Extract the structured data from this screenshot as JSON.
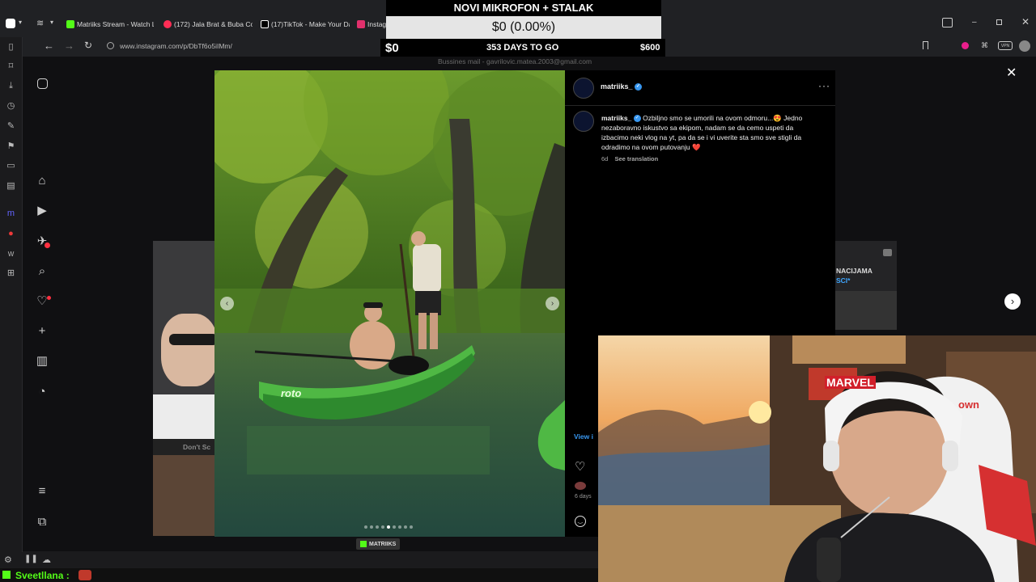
{
  "browser": {
    "tabs": [
      {
        "label": "Matriiks Stream - Watch Liv",
        "color": "#53fc18"
      },
      {
        "label": "(172) Jala Brat & Buba Corr",
        "color": "#ff2d55"
      },
      {
        "label": "(17)TikTok - Make Your Day",
        "color": "#ffffff"
      },
      {
        "label": "Instag",
        "color": "#e1306c"
      }
    ],
    "url": "www.instagram.com/p/DbTf6o5iIMm/"
  },
  "overlay": {
    "banner": "NOVI MIKROFON + STALAK",
    "goal_percent_text": "$0 (0.00%)",
    "goal_current": "$0",
    "days_to_go": "353 DAYS TO GO",
    "goal_target": "$600",
    "business_mail": "Bussines mail - gavrilovic.matea.2003@gmail.com"
  },
  "post": {
    "username": "matriiks_",
    "caption_user": "matriiks_",
    "caption": "Ozbiljno smo se umorili na ovom odmoru...😍 Jedno nezaboravno iskustvo sa ekipom, nadam se da cemo uspeti da izbacimo neki vlog na yt, pa da se i vi uverite sta smo sve stigli da odradimo na ovom putovanju ❤️",
    "age": "6d",
    "see_translation": "See translation",
    "view_text": "View i",
    "days_text": "6 days",
    "kayak_brand": "roto",
    "carousel_count": 9,
    "carousel_active": 4
  },
  "background_posts": {
    "left_text": "Don't Sc",
    "right_text_1": "NACIJAMA",
    "right_text_2": "SCI*"
  },
  "webcam": {
    "marvel_sign": "MARVEL",
    "chair_text": "own"
  },
  "footer": {
    "badge": "MATRIIKS"
  },
  "chat": {
    "user": "Sveetllana :",
    "user_color": "#53fc18"
  },
  "colors": {
    "accent_blue": "#3897f0",
    "kick_green": "#53fc18"
  }
}
